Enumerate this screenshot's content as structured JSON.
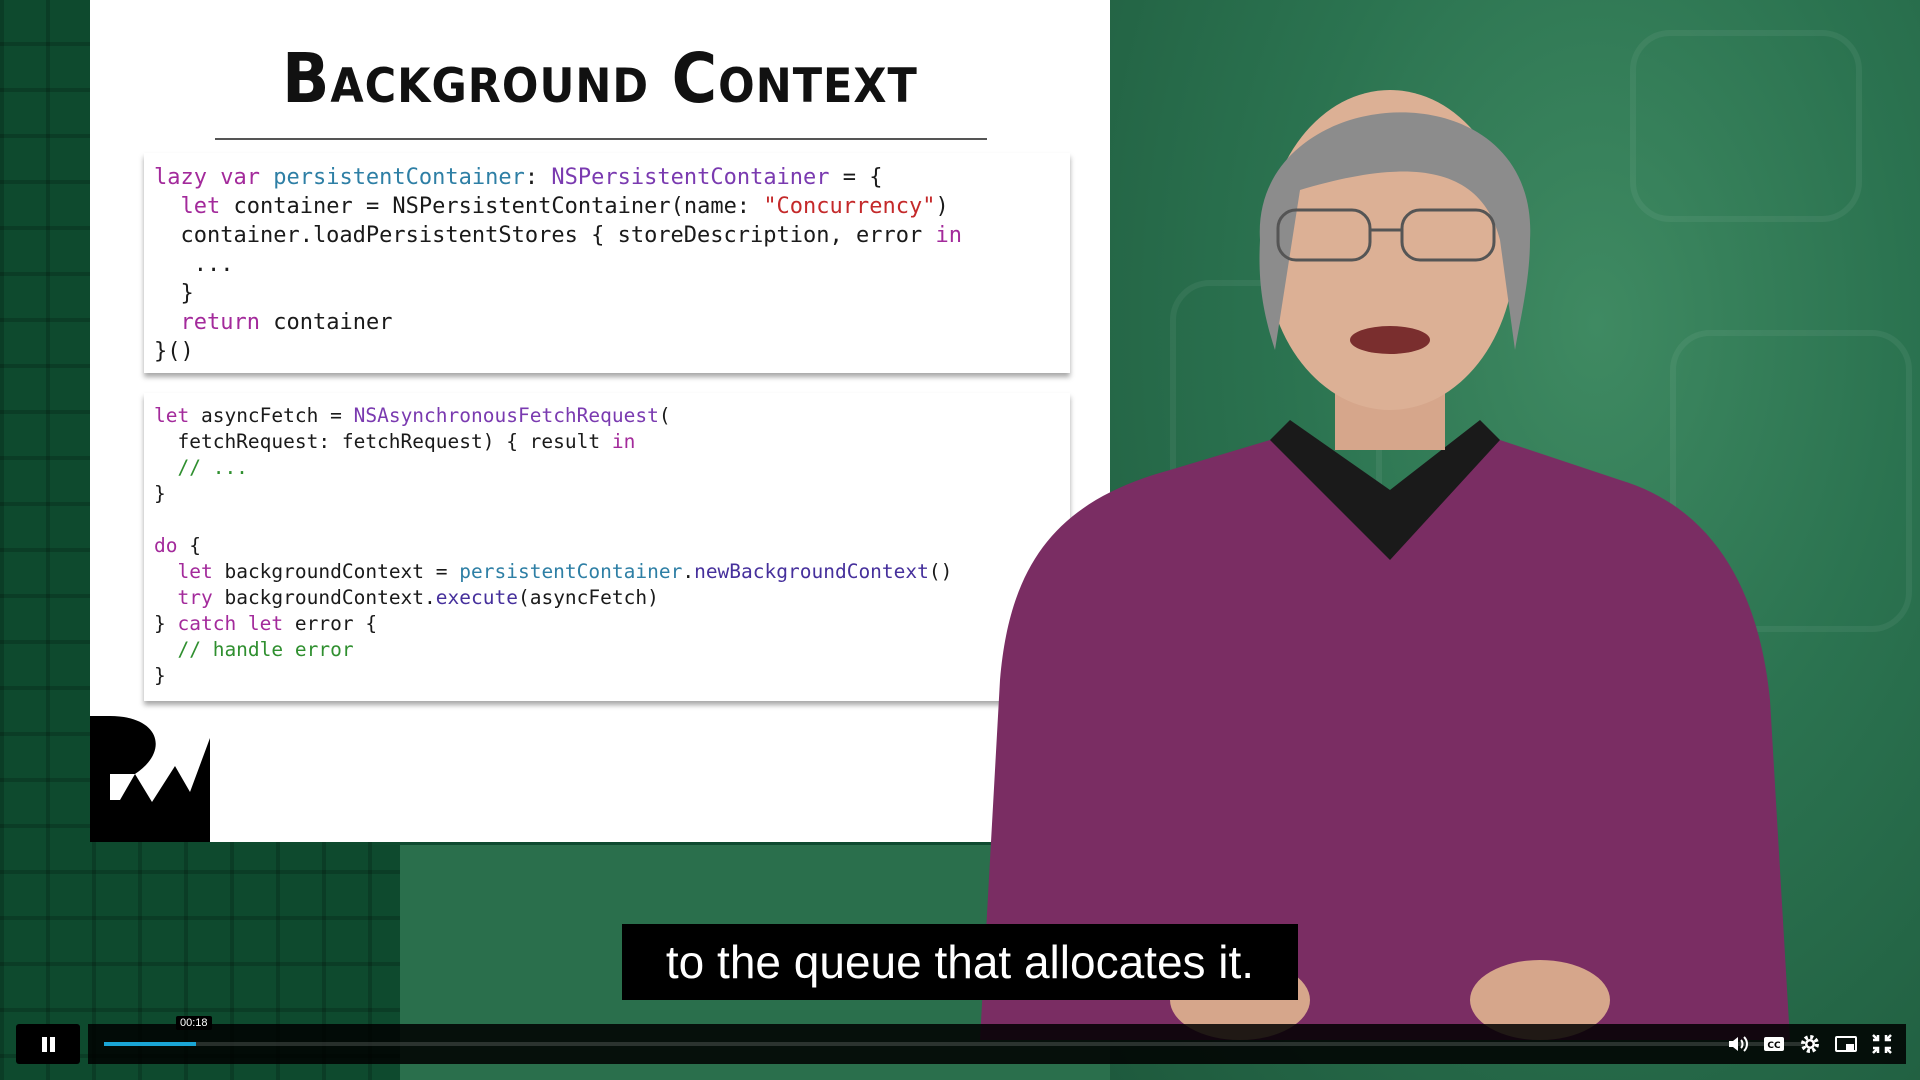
{
  "slide": {
    "title": "Background Context",
    "code1": [
      [
        {
          "t": "lazy var ",
          "c": "kw"
        },
        {
          "t": "persistentContainer",
          "c": "pr"
        },
        {
          "t": ": ",
          "c": ""
        },
        {
          "t": "NSPersistentContainer",
          "c": "ty"
        },
        {
          "t": " = {",
          "c": ""
        }
      ],
      [
        {
          "t": "  ",
          "c": ""
        },
        {
          "t": "let",
          "c": "kw"
        },
        {
          "t": " container = NSPersistentContainer(name: ",
          "c": ""
        },
        {
          "t": "\"Concurrency\"",
          "c": "st"
        },
        {
          "t": ")",
          "c": ""
        }
      ],
      [
        {
          "t": "  container.loadPersistentStores { storeDescription, error ",
          "c": ""
        },
        {
          "t": "in",
          "c": "kw"
        }
      ],
      [
        {
          "t": "   ...",
          "c": ""
        }
      ],
      [
        {
          "t": "  }",
          "c": ""
        }
      ],
      [
        {
          "t": "  ",
          "c": ""
        },
        {
          "t": "return",
          "c": "kw"
        },
        {
          "t": " container",
          "c": ""
        }
      ],
      [
        {
          "t": "}()",
          "c": ""
        }
      ]
    ],
    "code2": [
      [
        {
          "t": "let",
          "c": "kw"
        },
        {
          "t": " asyncFetch = ",
          "c": ""
        },
        {
          "t": "NSAsynchronousFetchRequest",
          "c": "ty"
        },
        {
          "t": "(",
          "c": ""
        }
      ],
      [
        {
          "t": "  fetchRequest: fetchRequest) { result ",
          "c": ""
        },
        {
          "t": "in",
          "c": "kw"
        }
      ],
      [
        {
          "t": "  // ...",
          "c": "cm"
        }
      ],
      [
        {
          "t": "}",
          "c": ""
        }
      ],
      [
        {
          "t": "",
          "c": ""
        }
      ],
      [
        {
          "t": "do",
          "c": "kw"
        },
        {
          "t": " {",
          "c": ""
        }
      ],
      [
        {
          "t": "  ",
          "c": ""
        },
        {
          "t": "let",
          "c": "kw"
        },
        {
          "t": " backgroundContext = ",
          "c": ""
        },
        {
          "t": "persistentContainer",
          "c": "pr"
        },
        {
          "t": ".",
          "c": ""
        },
        {
          "t": "newBackgroundContext",
          "c": "mt"
        },
        {
          "t": "()",
          "c": ""
        }
      ],
      [
        {
          "t": "  ",
          "c": ""
        },
        {
          "t": "try",
          "c": "kw"
        },
        {
          "t": " backgroundContext.",
          "c": ""
        },
        {
          "t": "execute",
          "c": "mt"
        },
        {
          "t": "(asyncFetch)",
          "c": ""
        }
      ],
      [
        {
          "t": "} ",
          "c": ""
        },
        {
          "t": "catch let",
          "c": "kw"
        },
        {
          "t": " error {",
          "c": ""
        }
      ],
      [
        {
          "t": "  // handle error",
          "c": "cm"
        }
      ],
      [
        {
          "t": "}",
          "c": ""
        }
      ]
    ]
  },
  "subtitle": "to the queue that allocates it.",
  "player": {
    "current_time": "00:18",
    "progress_fraction": 0.054,
    "icons": [
      "pause-icon",
      "volume-icon",
      "closed-captions-icon",
      "settings-gear-icon",
      "picture-in-picture-icon",
      "exit-fullscreen-icon"
    ]
  }
}
